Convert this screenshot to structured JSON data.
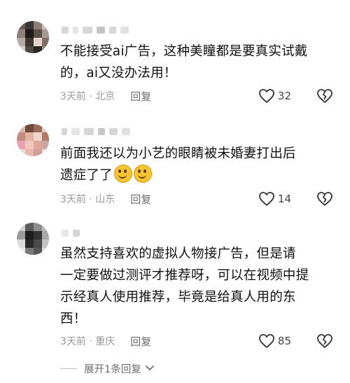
{
  "comments": [
    {
      "text": "不能接受ai广告，这种美瞳都是要真实试戴的，ai又没办法用！",
      "line1": "不能接受ai广告，这种美瞳都是要真实试戴",
      "line2": "的，ai又没办法用！",
      "time": "3天前 · 北京",
      "reply": "回复",
      "likes": "32"
    },
    {
      "text": "前面我还以为小艺的眼睛被未婚妻打出后遗症了了",
      "line1": "前面我还以为小艺的眼睛被未婚妻打出后",
      "line2": "遗症了了",
      "time": "3天前 · 山东",
      "reply": "回复",
      "likes": "14"
    },
    {
      "text": "虽然支持喜欢的虚拟人物接广告，但是请一定要做过测评才推荐呀，可以在视频中提示经真人使用推荐，毕竟是给真人用的东西！",
      "line1": "虽然支持喜欢的虚拟人物接广告，但是请",
      "line2": "一定要做过测评才推荐呀，可以在视频中提",
      "line3": "示经真人使用推荐，毕竟是给真人用的东",
      "line4": "西！",
      "time": "3天前 · 重庆",
      "reply": "回复",
      "likes": "85"
    }
  ],
  "expand_label": "展开1条回复",
  "icons": {
    "like": "heart-outline-icon",
    "dislike": "broken-heart-icon",
    "expand": "chevron-down-icon",
    "emoji": "grinning-face-emoji-icon"
  },
  "colors": {
    "meta_text": "#9a9a9a",
    "body_text": "#111111"
  }
}
